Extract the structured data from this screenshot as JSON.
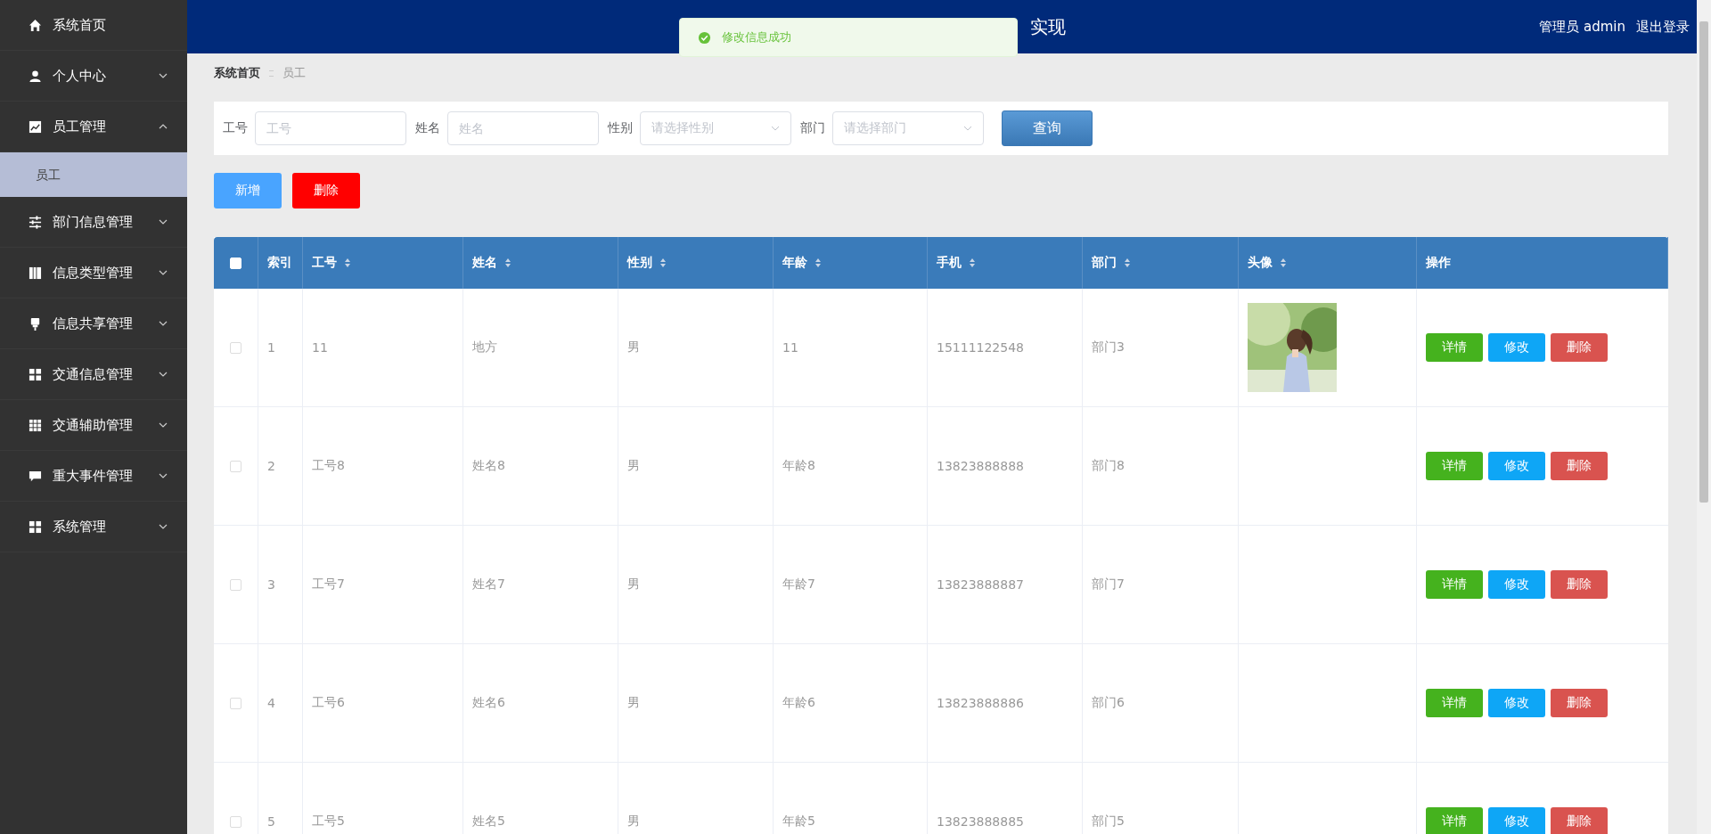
{
  "sidebar": {
    "items": [
      {
        "label": "系统首页",
        "expandable": false
      },
      {
        "label": "个人中心",
        "expandable": true,
        "expanded": false
      },
      {
        "label": "员工管理",
        "expandable": true,
        "expanded": true,
        "children": [
          {
            "label": "员工",
            "selected": true
          }
        ]
      },
      {
        "label": "部门信息管理",
        "expandable": true,
        "expanded": false
      },
      {
        "label": "信息类型管理",
        "expandable": true,
        "expanded": false
      },
      {
        "label": "信息共享管理",
        "expandable": true,
        "expanded": false
      },
      {
        "label": "交通信息管理",
        "expandable": true,
        "expanded": false
      },
      {
        "label": "交通辅助管理",
        "expandable": true,
        "expanded": false
      },
      {
        "label": "重大事件管理",
        "expandable": true,
        "expanded": false
      },
      {
        "label": "系统管理",
        "expandable": true,
        "expanded": false
      }
    ]
  },
  "header": {
    "title": "实现",
    "user": "管理员 admin",
    "logout": "退出登录"
  },
  "toast": {
    "kind": "success",
    "message": "修改信息成功"
  },
  "breadcrumb": [
    "系统首页",
    "员工"
  ],
  "filters": [
    {
      "kind": "input",
      "label": "工号",
      "placeholder": "工号"
    },
    {
      "kind": "input",
      "label": "姓名",
      "placeholder": "姓名"
    },
    {
      "kind": "select",
      "label": "性别",
      "placeholder": "请选择性别"
    },
    {
      "kind": "select",
      "label": "部门",
      "placeholder": "请选择部门"
    }
  ],
  "search_button": "查询",
  "actions": [
    {
      "kind": "add",
      "label": "新增"
    },
    {
      "kind": "delete",
      "label": "删除"
    }
  ],
  "table": {
    "select_all": {
      "checked": false
    },
    "columns": [
      {
        "label": "索引",
        "sortable": false
      },
      {
        "label": "工号",
        "sortable": true
      },
      {
        "label": "姓名",
        "sortable": true
      },
      {
        "label": "性别",
        "sortable": true
      },
      {
        "label": "年龄",
        "sortable": true
      },
      {
        "label": "手机",
        "sortable": true
      },
      {
        "label": "部门",
        "sortable": true
      },
      {
        "label": "头像",
        "sortable": true
      },
      {
        "label": "操作",
        "sortable": false
      }
    ],
    "rows": [
      {
        "checked": false,
        "cells": [
          "1",
          "11",
          "地方",
          "男",
          "11",
          "15111122548",
          "部门3"
        ],
        "avatar": {
          "kind": "picture"
        },
        "buttons": [
          {
            "kind": "detail",
            "label": "详情"
          },
          {
            "kind": "edit",
            "label": "修改"
          },
          {
            "kind": "delete",
            "label": "删除"
          }
        ]
      },
      {
        "checked": false,
        "cells": [
          "2",
          "工号8",
          "姓名8",
          "男",
          "年龄8",
          "13823888888",
          "部门8"
        ],
        "buttons": [
          {
            "kind": "detail",
            "label": "详情"
          },
          {
            "kind": "edit",
            "label": "修改"
          },
          {
            "kind": "delete",
            "label": "删除"
          }
        ]
      },
      {
        "checked": false,
        "cells": [
          "3",
          "工号7",
          "姓名7",
          "男",
          "年龄7",
          "13823888887",
          "部门7"
        ],
        "buttons": [
          {
            "kind": "detail",
            "label": "详情"
          },
          {
            "kind": "edit",
            "label": "修改"
          },
          {
            "kind": "delete",
            "label": "删除"
          }
        ]
      },
      {
        "checked": false,
        "cells": [
          "4",
          "工号6",
          "姓名6",
          "男",
          "年龄6",
          "13823888886",
          "部门6"
        ],
        "buttons": [
          {
            "kind": "detail",
            "label": "详情"
          },
          {
            "kind": "edit",
            "label": "修改"
          },
          {
            "kind": "delete",
            "label": "删除"
          }
        ]
      },
      {
        "checked": false,
        "cells": [
          "5",
          "工号5",
          "姓名5",
          "男",
          "年龄5",
          "13823888885",
          "部门5"
        ],
        "buttons": [
          {
            "kind": "detail",
            "label": "详情"
          },
          {
            "kind": "edit",
            "label": "修改"
          },
          {
            "kind": "delete",
            "label": "删除"
          }
        ]
      }
    ]
  }
}
